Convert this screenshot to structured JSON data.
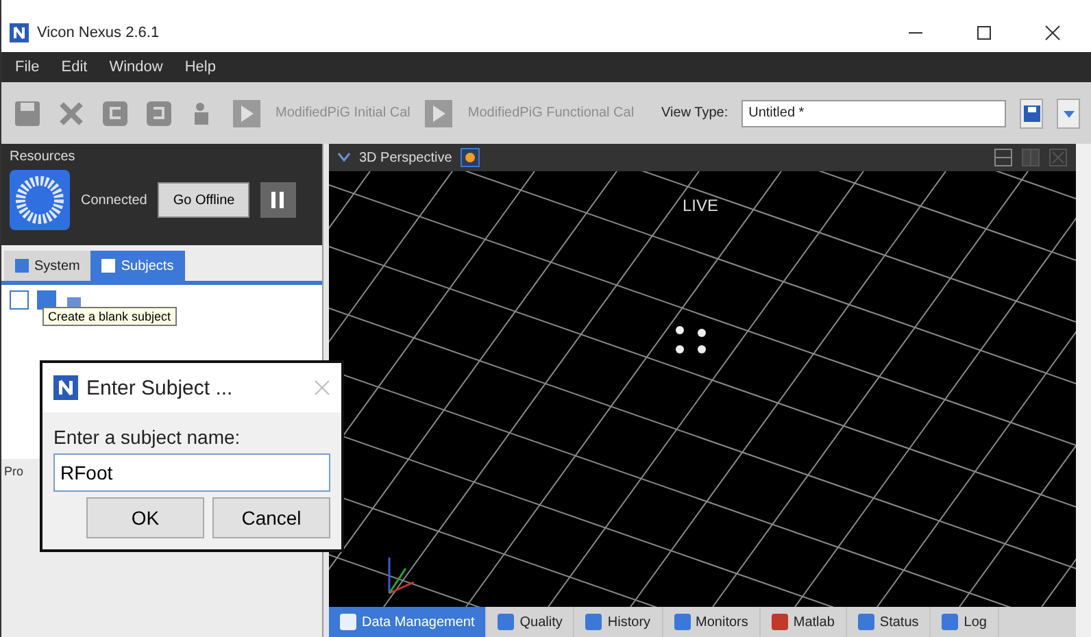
{
  "window": {
    "title": "Vicon Nexus 2.6.1"
  },
  "menu": [
    "File",
    "Edit",
    "Window",
    "Help"
  ],
  "toolbar": {
    "pipelines": [
      {
        "label": "ModifiedPiG Initial Cal",
        "disabled": true
      },
      {
        "label": "ModifiedPiG Functional Cal",
        "disabled": true
      }
    ],
    "view_type_label": "View Type:",
    "view_type_value": "Untitled *"
  },
  "resources": {
    "title": "Resources",
    "status": "Connected",
    "go_offline": "Go Offline",
    "tabs": [
      {
        "label": "System",
        "selected": false
      },
      {
        "label": "Subjects",
        "selected": true
      }
    ],
    "tooltip": "Create a blank subject",
    "footer_text": "Pro"
  },
  "viewport": {
    "title": "3D Perspective",
    "overlay": "LIVE"
  },
  "bottom_tabs": [
    {
      "label": "Data Management",
      "selected": true
    },
    {
      "label": "Quality",
      "selected": false
    },
    {
      "label": "History",
      "selected": false
    },
    {
      "label": "Monitors",
      "selected": false
    },
    {
      "label": "Matlab",
      "selected": false
    },
    {
      "label": "Status",
      "selected": false
    },
    {
      "label": "Log",
      "selected": false
    }
  ],
  "dialog": {
    "title": "Enter Subject ...",
    "prompt": "Enter a subject name:",
    "value": "RFoot",
    "buttons": [
      "OK",
      "Cancel"
    ]
  }
}
